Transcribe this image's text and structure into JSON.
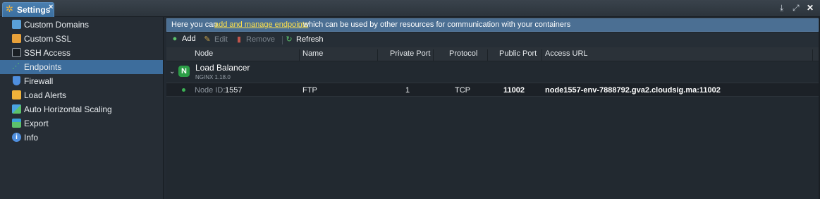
{
  "window": {
    "tab_title": "Settings",
    "tab_close": "×",
    "controls": {
      "minimize": "⤓",
      "expand": "⤢",
      "close": "✕"
    }
  },
  "sidebar": {
    "items": [
      {
        "label": "Custom Domains",
        "icon": "custom-domains-icon",
        "color": "#5aa0d8",
        "active": false
      },
      {
        "label": "Custom SSL",
        "icon": "ssl-certificate-icon",
        "color": "#e8a13a",
        "active": false
      },
      {
        "label": "SSH Access",
        "icon": "terminal-icon",
        "color": "#9aa3ac",
        "active": false
      },
      {
        "label": "Endpoints",
        "icon": "endpoints-icon",
        "color": "#5cc16b",
        "active": true
      },
      {
        "label": "Firewall",
        "icon": "shield-icon",
        "color": "#4f8fdf",
        "active": false
      },
      {
        "label": "Load Alerts",
        "icon": "load-alerts-icon",
        "color": "#f0b23a",
        "active": false
      },
      {
        "label": "Auto Horizontal Scaling",
        "icon": "scaling-icon",
        "color": "#4aa3e0",
        "active": false
      },
      {
        "label": "Export",
        "icon": "export-icon",
        "color": "#3aa0d8",
        "active": false
      },
      {
        "label": "Info",
        "icon": "info-icon",
        "color": "#4f8fdf",
        "active": false
      }
    ]
  },
  "info_bar": {
    "prefix": "Here you can ",
    "link": "add and manage endpoints",
    "suffix": ", which can be used by other resources for communication with your containers"
  },
  "toolbar": {
    "add": "Add",
    "edit": "Edit",
    "remove": "Remove",
    "refresh": "Refresh"
  },
  "columns": {
    "node": "Node",
    "name": "Name",
    "private_port": "Private Port",
    "protocol": "Protocol",
    "public_port": "Public Port",
    "access_url": "Access URL"
  },
  "group": {
    "name": "Load Balancer",
    "version": "NGINX 1.18.0",
    "badge": "N"
  },
  "rows": [
    {
      "node_prefix": "Node ID:",
      "node_id": "1557",
      "name": "FTP",
      "private_port": "1",
      "protocol": "TCP",
      "public_port": "11002",
      "access_url": "node1557-env-7888792.gva2.cloudsig.ma:11002"
    }
  ],
  "colors": {
    "accent": "#3d6d9c",
    "info_bg": "#4b6f93",
    "link": "#ffe24a",
    "status_green": "#3cb054"
  }
}
